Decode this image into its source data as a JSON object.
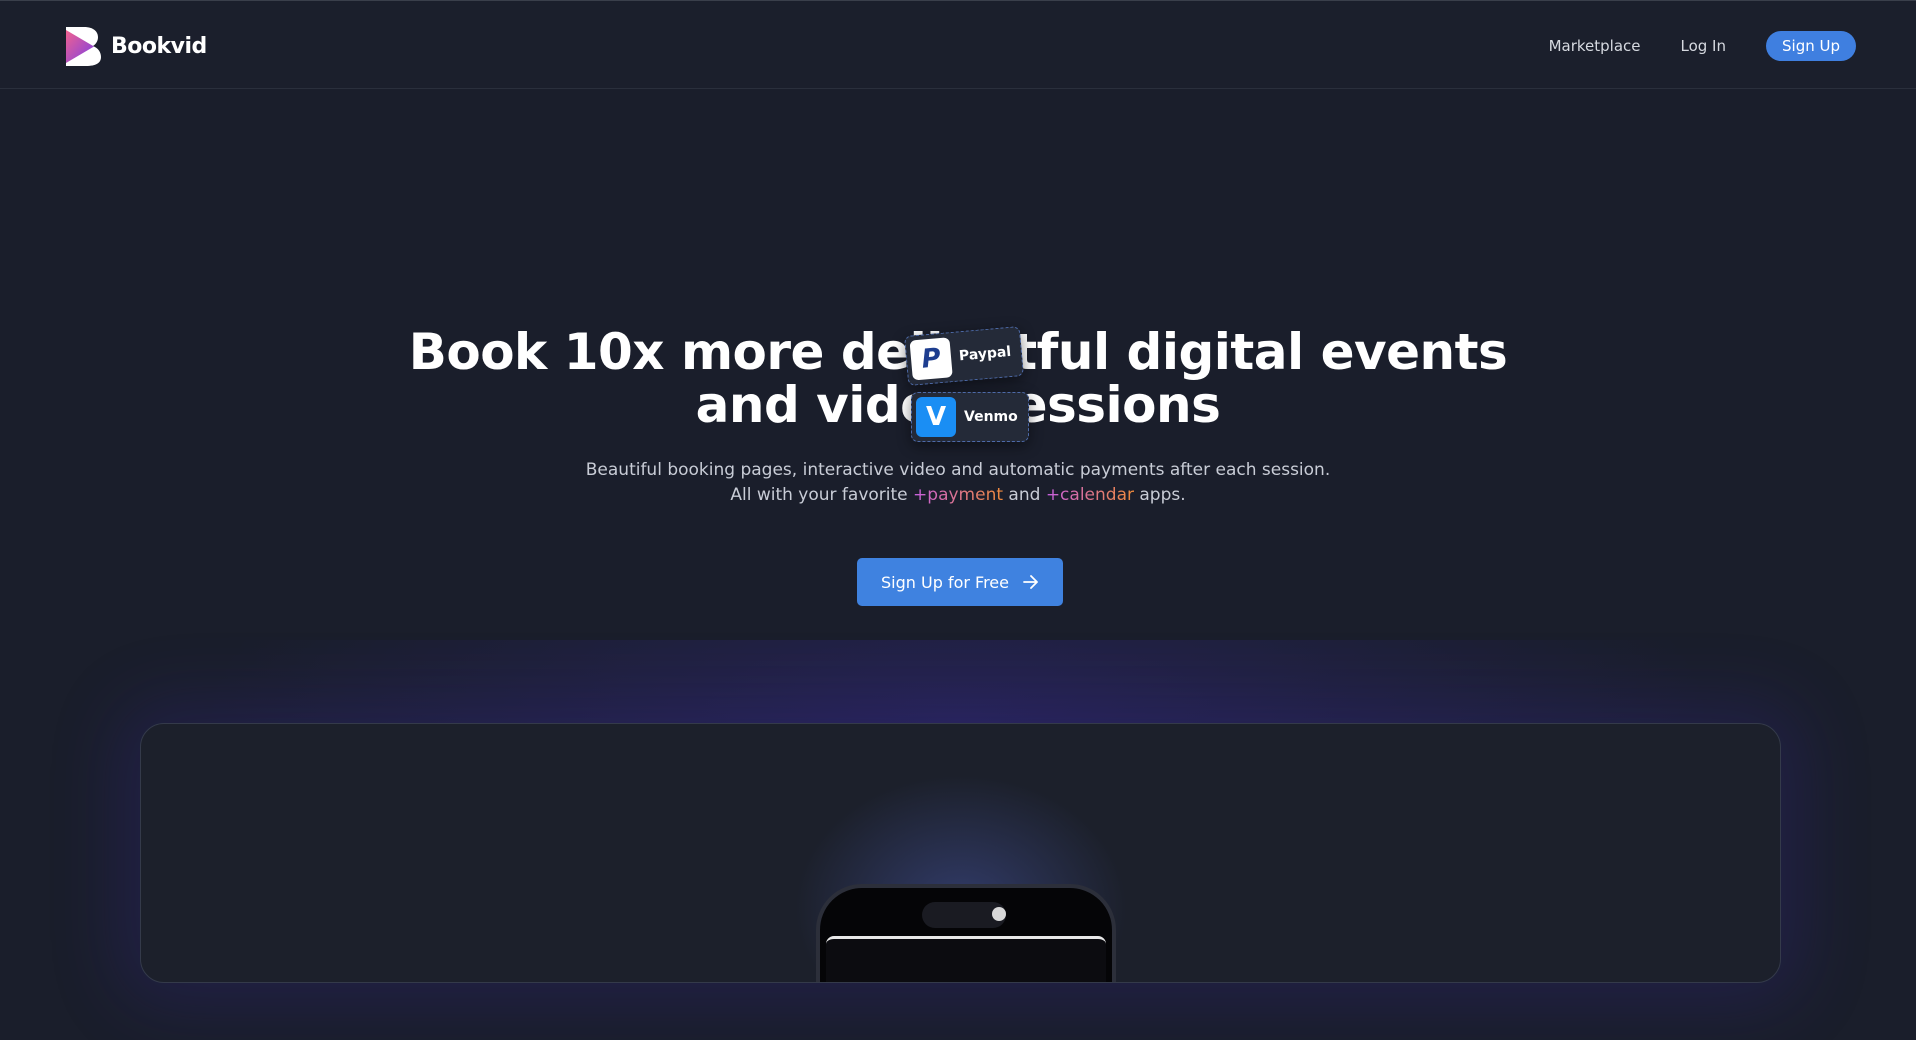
{
  "header": {
    "brand": "Bookvid",
    "nav": {
      "marketplace": "Marketplace",
      "login": "Log In",
      "signup": "Sign Up"
    }
  },
  "hero": {
    "title_line1": "Book 10x more delightful digital events",
    "title_line2": "and video sessions",
    "chips": [
      {
        "label": "Paypal",
        "icon": "paypal-icon",
        "color": "#1d3d8f"
      },
      {
        "label": "Venmo",
        "icon": "venmo-icon",
        "color": "#1a8ef4"
      }
    ],
    "subtitle_line1": "Beautiful booking pages, interactive video and automatic payments after each session.",
    "subtitle_pre": "All with your favorite",
    "subtitle_payment": "+payment",
    "subtitle_and": "and",
    "subtitle_calendar": "+calendar",
    "subtitle_post": "apps.",
    "cta_label": "Sign Up for Free",
    "cta_icon": "arrow-right-icon"
  },
  "colors": {
    "background": "#1a1e2b",
    "accent": "#3f82e0",
    "gradient_start": "#c65fe0",
    "gradient_end": "#f08a3a"
  }
}
